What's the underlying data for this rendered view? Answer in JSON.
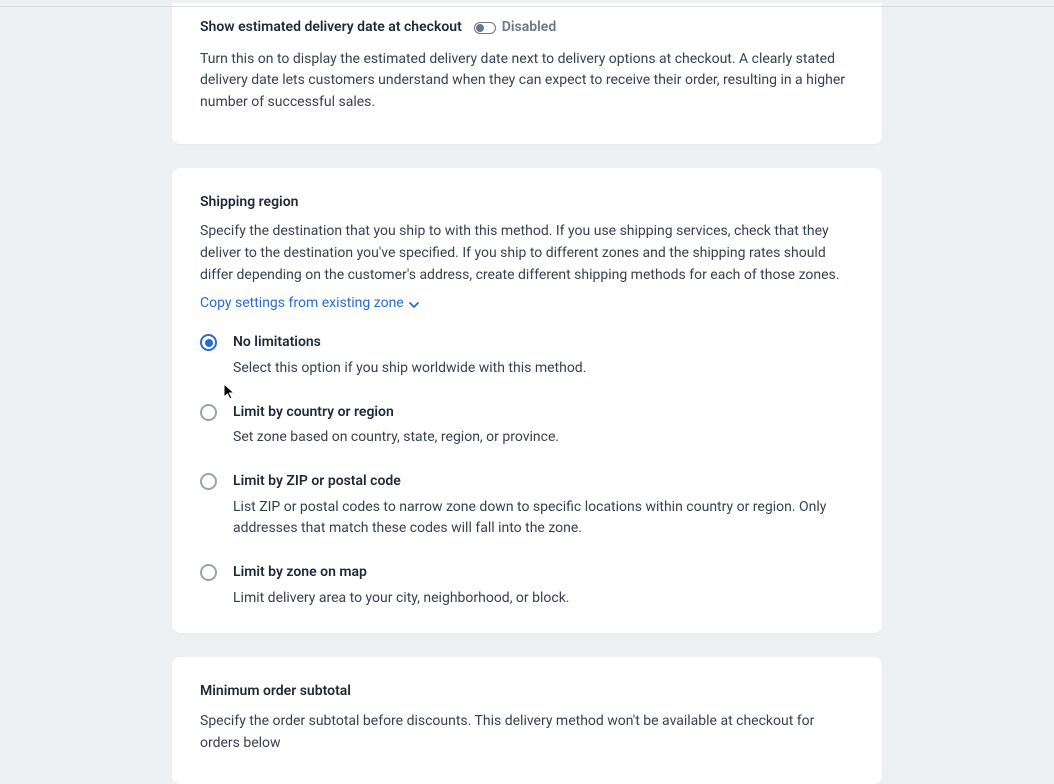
{
  "delivery_date": {
    "title": "Show estimated delivery date at checkout",
    "status_label": "Disabled",
    "description": "Turn this on to display the estimated delivery date next to delivery options at checkout. A clearly stated delivery date lets customers understand when they can expect to receive their order, resulting in a higher number of successful sales."
  },
  "shipping_region": {
    "title": "Shipping region",
    "description": "Specify the destination that you ship to with this method. If you use shipping services, check that they deliver to the destination you've specified. If you ship to different zones and the shipping rates should differ depending on the customer's address, create different shipping methods for each of those zones.",
    "copy_link": "Copy settings from existing zone",
    "options": [
      {
        "label": "No limitations",
        "desc": "Select this option if you ship worldwide with this method.",
        "selected": true
      },
      {
        "label": "Limit by country or region",
        "desc": "Set zone based on country, state, region, or province.",
        "selected": false
      },
      {
        "label": "Limit by ZIP or postal code",
        "desc": "List ZIP or postal codes to narrow zone down to specific locations within country or region. Only addresses that match these codes will fall into the zone.",
        "selected": false
      },
      {
        "label": "Limit by zone on map",
        "desc": "Limit delivery area to your city, neighborhood, or block.",
        "selected": false
      }
    ]
  },
  "min_order": {
    "title": "Minimum order subtotal",
    "description": "Specify the order subtotal before discounts. This delivery method won't be available at checkout for orders below"
  }
}
